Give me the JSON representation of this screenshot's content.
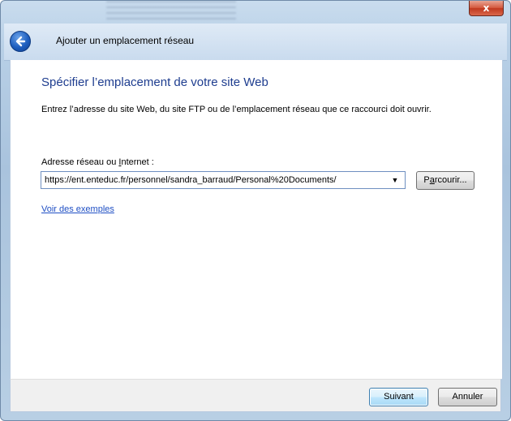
{
  "window": {
    "close_label": "x",
    "header_title": "Ajouter un emplacement réseau"
  },
  "content": {
    "title": "Spécifier l’emplacement de votre site Web",
    "instruction": "Entrez l’adresse du site Web, du site FTP ou de l’emplacement réseau que ce raccourci doit ouvrir.",
    "address_label_pre": "Adresse réseau ou ",
    "address_label_underlined": "I",
    "address_label_post": "nternet :",
    "address_value": "https://ent.enteduc.fr/personnel/sandra_barraud/Personal%20Documents/",
    "dropdown_arrow": "▼",
    "browse_pre": "P",
    "browse_underlined": "a",
    "browse_post": "rcourir...",
    "examples_link": "Voir des exemples"
  },
  "footer": {
    "next_label": "Suivant",
    "cancel_label": "Annuler"
  },
  "icons": {
    "back": "back-arrow-icon",
    "close": "close-icon",
    "dropdown": "chevron-down-icon"
  },
  "colors": {
    "title_blue": "#1e3d8f",
    "link_blue": "#1f4fc4",
    "close_red": "#c0391f"
  }
}
